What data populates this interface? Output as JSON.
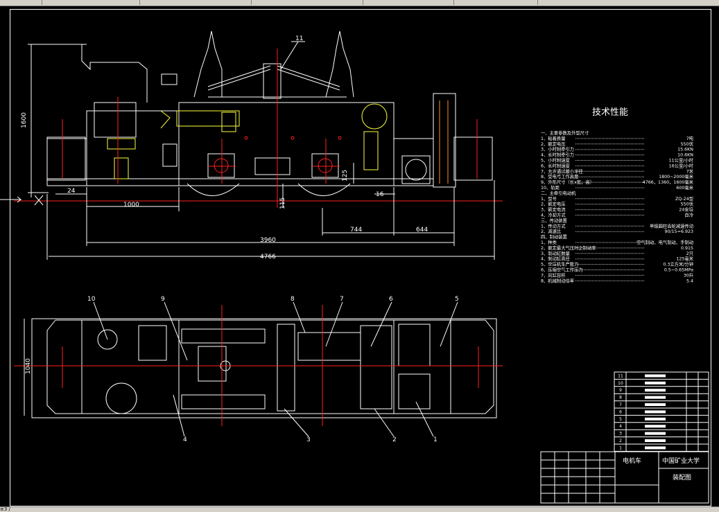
{
  "tech": {
    "title": "技术性能",
    "sections": [
      {
        "heading": "一、主要参数及外型尺寸",
        "rows": [
          [
            "1、粘着质量",
            "7吨"
          ],
          [
            "2、额定电压",
            "550伏"
          ],
          [
            "3、小时制牵引力",
            "15.6KN"
          ],
          [
            "4、长时制牵引力",
            "10.6KN"
          ],
          [
            "5、小时制速度",
            "11公里/小时"
          ],
          [
            "6、长时制速度",
            "16公里/小时"
          ],
          [
            "7、允许通过最小半径",
            "7米"
          ],
          [
            "8、受电弓工作高度",
            "1800~2000毫米"
          ],
          [
            "9、外形尺寸（长x宽，高）",
            "4766，1360，1600毫米"
          ],
          [
            "10、轨距",
            "600毫米"
          ]
        ]
      },
      {
        "heading": "二、主牵引电动机",
        "rows": [
          [
            "1、型号",
            "ZQ-24型"
          ],
          [
            "2、额定电压",
            "550伏"
          ],
          [
            "3、额定电流",
            "24安培"
          ],
          [
            "4、冷却方式",
            "自冷"
          ]
        ]
      },
      {
        "heading": "三、传动装置",
        "rows": [
          [
            "1、传动方式",
            "单级圆柱齿轮减速传动"
          ],
          [
            "2、减速比",
            "90/15=6.923"
          ]
        ]
      },
      {
        "heading": "四、制动装置",
        "rows": [
          [
            "1、种类",
            "空气制动、电气制动、手制动"
          ],
          [
            "2、额定最大气压时之制动率",
            "0.915"
          ],
          [
            "3、制动缸数量",
            "2只"
          ],
          [
            "4、制动缸直径",
            "125毫米"
          ],
          [
            "5、空压机生产能力",
            "0.3立方米/分钟"
          ],
          [
            "6、压缩空气工作压力",
            "0.5~0.65MPa"
          ],
          [
            "7、风缸容积",
            "30升"
          ],
          [
            "8、机械制动倍率",
            "5.4"
          ]
        ]
      }
    ]
  },
  "dims": {
    "d1600": "1600",
    "d24": "24",
    "d1000": "1000",
    "d115": "115",
    "d125": "125",
    "d16": "16",
    "d744": "744",
    "d644": "644",
    "d3960": "3960",
    "d4766": "4766",
    "d1040": "1040"
  },
  "balloons": [
    "1",
    "2",
    "3",
    "4",
    "5",
    "6",
    "7",
    "8",
    "9",
    "10",
    "11"
  ],
  "titleblock": {
    "name": "电机车",
    "school": "中国矿业大学",
    "drawing": "装配图"
  },
  "bom_numbers": [
    "11",
    "10",
    "9",
    "8",
    "7",
    "6",
    "5",
    "4",
    "3",
    "2",
    "1"
  ],
  "statusbar": "≡3 /"
}
